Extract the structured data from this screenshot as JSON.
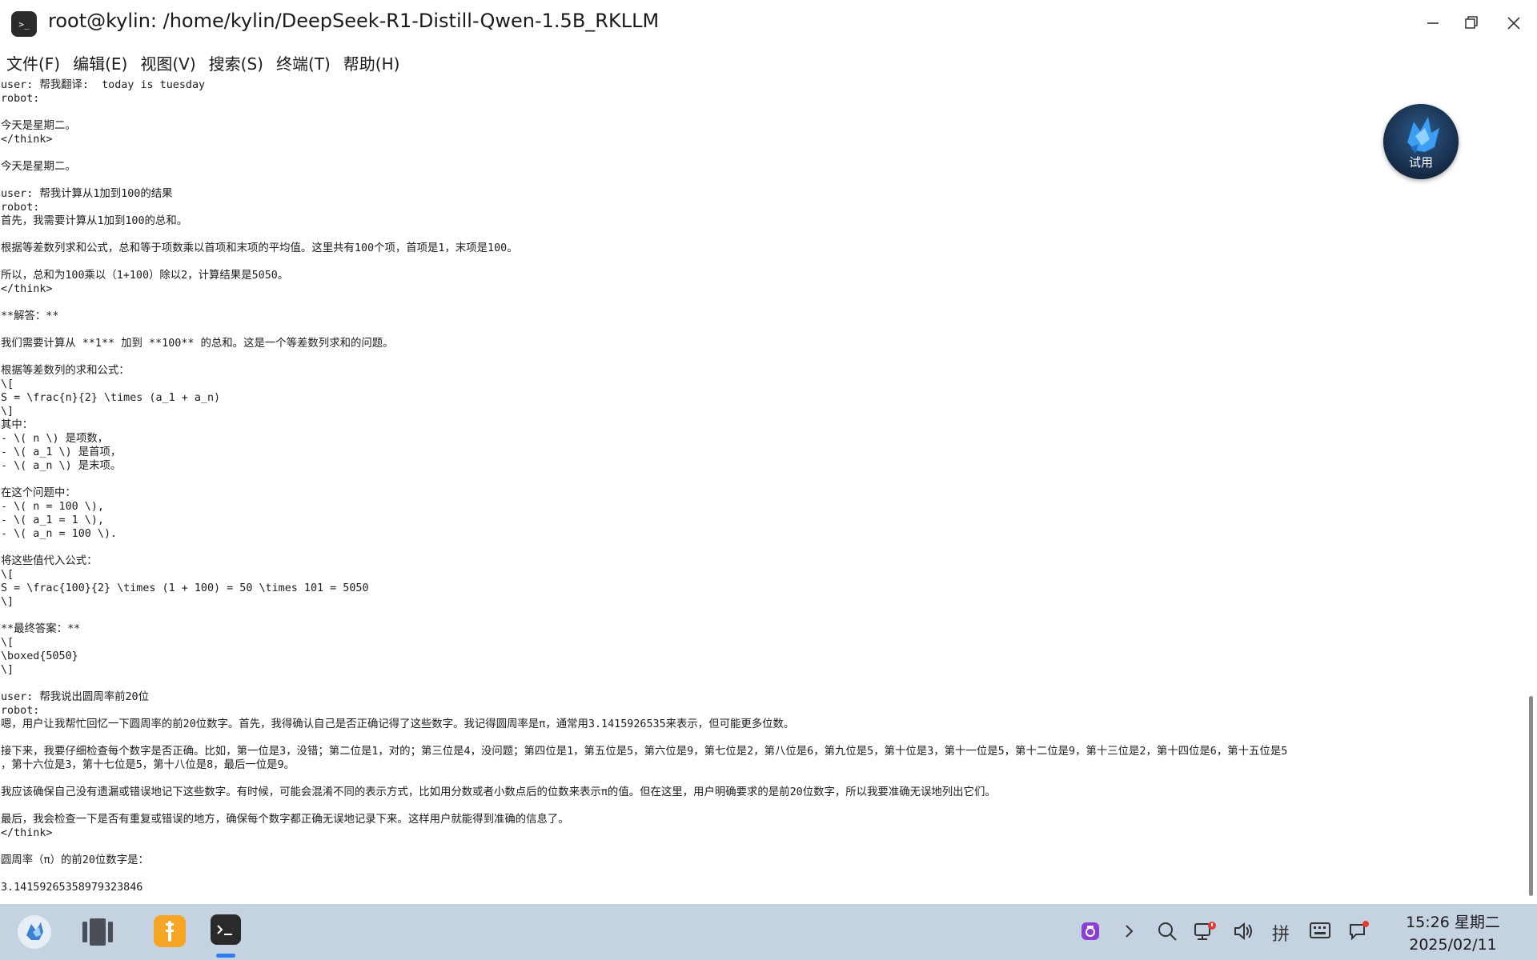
{
  "window": {
    "title": "root@kylin: /home/kylin/DeepSeek-R1-Distill-Qwen-1.5B_RKLLM",
    "app_icon_text": ">_"
  },
  "menu": {
    "items": [
      "文件(F)",
      "编辑(E)",
      "视图(V)",
      "搜索(S)",
      "终端(T)",
      "帮助(H)"
    ]
  },
  "terminal": {
    "lines": [
      "user: 帮我翻译:  today is tuesday",
      "robot:",
      "",
      "今天是星期二。",
      "</think>",
      "",
      "今天是星期二。",
      "",
      "user: 帮我计算从1加到100的结果",
      "robot:",
      "首先，我需要计算从1加到100的总和。",
      "",
      "根据等差数列求和公式，总和等于项数乘以首项和末项的平均值。这里共有100个项，首项是1，末项是100。",
      "",
      "所以，总和为100乘以（1+100）除以2，计算结果是5050。",
      "</think>",
      "",
      "**解答：**",
      "",
      "我们需要计算从 **1** 加到 **100** 的总和。这是一个等差数列求和的问题。",
      "",
      "根据等差数列的求和公式：",
      "\\[",
      "S = \\frac{n}{2} \\times (a_1 + a_n)",
      "\\]",
      "其中：",
      "- \\( n \\) 是项数，",
      "- \\( a_1 \\) 是首项，",
      "- \\( a_n \\) 是末项。",
      "",
      "在这个问题中：",
      "- \\( n = 100 \\),",
      "- \\( a_1 = 1 \\),",
      "- \\( a_n = 100 \\).",
      "",
      "将这些值代入公式：",
      "\\[",
      "S = \\frac{100}{2} \\times (1 + 100) = 50 \\times 101 = 5050",
      "\\]",
      "",
      "**最终答案：**",
      "\\[",
      "\\boxed{5050}",
      "\\]",
      "",
      "user: 帮我说出圆周率前20位",
      "robot:",
      "嗯，用户让我帮忙回忆一下圆周率的前20位数字。首先，我得确认自己是否正确记得了这些数字。我记得圆周率是π，通常用3.1415926535来表示，但可能更多位数。",
      "",
      "接下来，我要仔细检查每个数字是否正确。比如，第一位是3，没错；第二位是1，对的；第三位是4，没问题；第四位是1，第五位是5，第六位是9，第七位是2，第八位是6，第九位是5，第十位是3，第十一位是5，第十二位是9，第十三位是2，第十四位是6，第十五位是5",
      "，第十六位是3，第十七位是5，第十八位是8，最后一位是9。",
      "",
      "我应该确保自己没有遗漏或错误地记下这些数字。有时候，可能会混淆不同的表示方式，比如用分数或者小数点后的位数来表示π的值。但在这里，用户明确要求的是前20位数字，所以我要准确无误地列出它们。",
      "",
      "最后，我会检查一下是否有重复或错误的地方，确保每个数字都正确无误地记录下来。这样用户就能得到准确的信息了。",
      "</think>",
      "",
      "圆周率（π）的前20位数字是：",
      "",
      "3.14159265358979323846"
    ]
  },
  "floating_badge": {
    "label": "试用"
  },
  "taskbar": {
    "ime_label": "拼",
    "clock_time": "15:26 星期二",
    "clock_date": "2025/02/11"
  },
  "colors": {
    "taskbar_bg": "#c5d2e2",
    "accent": "#2f7cf6",
    "notification_dot": "#e53935"
  }
}
